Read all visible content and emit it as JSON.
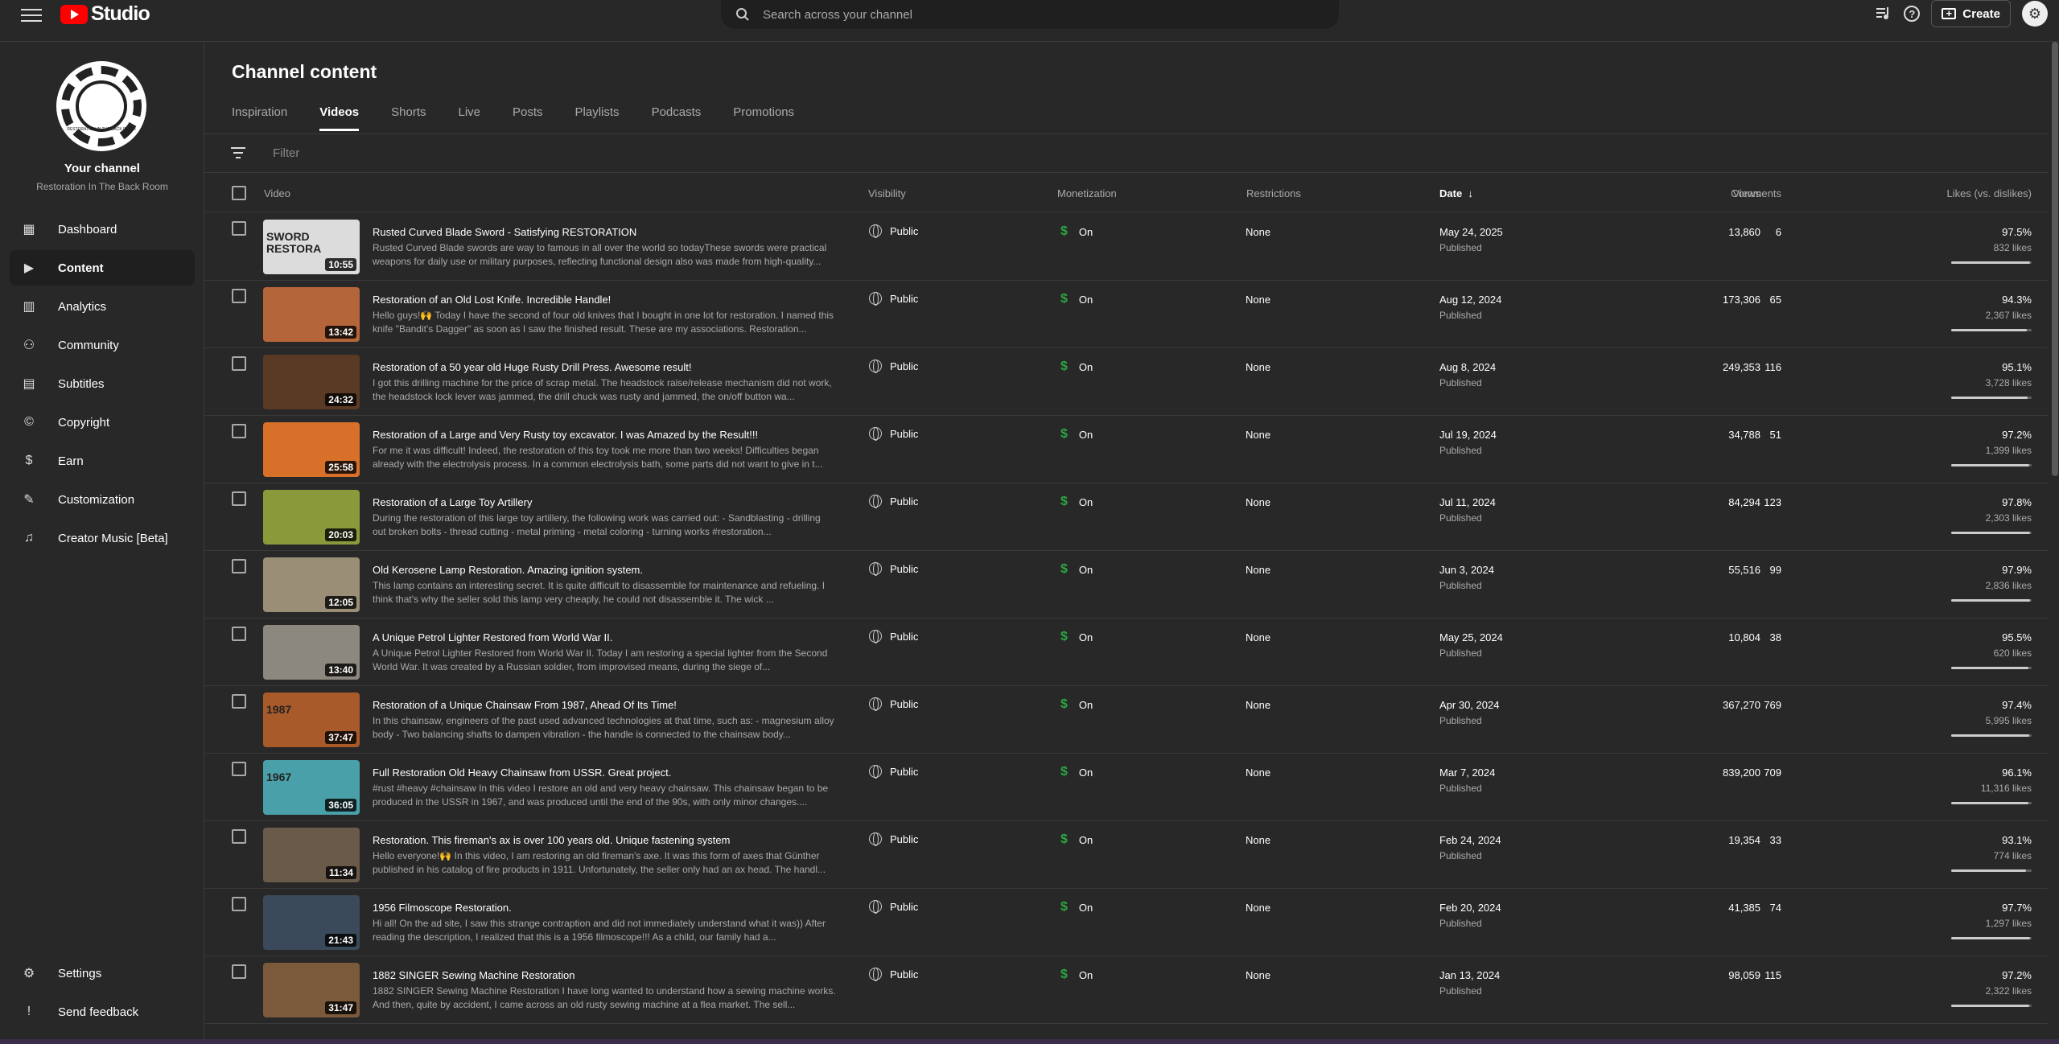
{
  "header": {
    "logo_text": "Studio",
    "search_placeholder": "Search across your channel",
    "create_label": "Create"
  },
  "sidebar": {
    "your_channel": "Your channel",
    "channel_name": "Restoration In The Back Room",
    "avatar_text": "RESTORATION IN THE BACK ROOM",
    "items": [
      {
        "label": "Dashboard",
        "icon": "dashboard-icon"
      },
      {
        "label": "Content",
        "icon": "content-icon"
      },
      {
        "label": "Analytics",
        "icon": "analytics-icon"
      },
      {
        "label": "Community",
        "icon": "community-icon"
      },
      {
        "label": "Subtitles",
        "icon": "subtitles-icon"
      },
      {
        "label": "Copyright",
        "icon": "copyright-icon"
      },
      {
        "label": "Earn",
        "icon": "earn-icon"
      },
      {
        "label": "Customization",
        "icon": "customization-icon"
      },
      {
        "label": "Creator Music [Beta]",
        "icon": "music-icon"
      }
    ],
    "settings": "Settings",
    "feedback": "Send feedback"
  },
  "main": {
    "title": "Channel content",
    "tabs": [
      "Inspiration",
      "Videos",
      "Shorts",
      "Live",
      "Posts",
      "Playlists",
      "Podcasts",
      "Promotions"
    ],
    "active_tab": "Videos",
    "filter_placeholder": "Filter",
    "columns": {
      "video": "Video",
      "visibility": "Visibility",
      "monetization": "Monetization",
      "restrictions": "Restrictions",
      "date": "Date",
      "views": "Views",
      "comments": "Comments",
      "likes": "Likes (vs. dislikes)"
    }
  },
  "rows": [
    {
      "title": "Rusted Curved Blade Sword - Satisfying RESTORATION",
      "desc": "Rusted Curved Blade swords are way to famous in all over the world so todayThese swords were practical weapons for daily use or military purposes, reflecting functional design also was made from high-quality...",
      "duration": "10:55",
      "visibility": "Public",
      "monetization": "On",
      "restrictions": "None",
      "date": "May 24, 2025",
      "status": "Published",
      "views": "13,860",
      "comments": "6",
      "likes_pct": "97.5%",
      "likes_count": "832 likes",
      "like_ratio": 0.975,
      "thumb_color": "#dcdcdc",
      "thumb_text": "SWORD RESTORA"
    },
    {
      "title": "Restoration of an Old Lost Knife. Incredible Handle!",
      "desc": "Hello guys!🙌 Today I have the second of four old knives that I bought in one lot for restoration. I named this knife \"Bandit's Dagger\" as soon as I saw the finished result. These are my associations. Restoration...",
      "duration": "13:42",
      "visibility": "Public",
      "monetization": "On",
      "restrictions": "None",
      "date": "Aug 12, 2024",
      "status": "Published",
      "views": "173,306",
      "comments": "65",
      "likes_pct": "94.3%",
      "likes_count": "2,367 likes",
      "like_ratio": 0.943,
      "thumb_color": "#b5653a",
      "thumb_text": ""
    },
    {
      "title": "Restoration of a 50 year old Huge Rusty Drill Press. Awesome result!",
      "desc": "I got this drilling machine for the price of scrap metal. The headstock raise/release mechanism did not work, the headstock lock lever was jammed, the drill chuck was rusty and jammed, the on/off button wa...",
      "duration": "24:32",
      "visibility": "Public",
      "monetization": "On",
      "restrictions": "None",
      "date": "Aug 8, 2024",
      "status": "Published",
      "views": "249,353",
      "comments": "116",
      "likes_pct": "95.1%",
      "likes_count": "3,728 likes",
      "like_ratio": 0.951,
      "thumb_color": "#5a3a24",
      "thumb_text": ""
    },
    {
      "title": "Restoration of a Large and Very Rusty toy excavator. I was Amazed by the Result!!!",
      "desc": "For me it was difficult! Indeed, the restoration of this toy took me more than two weeks! Difficulties began already with the electrolysis process. In a common electrolysis bath, some parts did not want to give in t...",
      "duration": "25:58",
      "visibility": "Public",
      "monetization": "On",
      "restrictions": "None",
      "date": "Jul 19, 2024",
      "status": "Published",
      "views": "34,788",
      "comments": "51",
      "likes_pct": "97.2%",
      "likes_count": "1,399 likes",
      "like_ratio": 0.972,
      "thumb_color": "#d8702a",
      "thumb_text": ""
    },
    {
      "title": "Restoration of a Large Toy Artillery",
      "desc": "During the restoration of this large toy artillery, the following work was carried out: - Sandblasting - drilling out broken bolts - thread cutting - metal priming - metal coloring - turning works #restoration...",
      "duration": "20:03",
      "visibility": "Public",
      "monetization": "On",
      "restrictions": "None",
      "date": "Jul 11, 2024",
      "status": "Published",
      "views": "84,294",
      "comments": "123",
      "likes_pct": "97.8%",
      "likes_count": "2,303 likes",
      "like_ratio": 0.978,
      "thumb_color": "#8a9a3a",
      "thumb_text": ""
    },
    {
      "title": "Old Kerosene Lamp Restoration. Amazing ignition system.",
      "desc": "This lamp contains an interesting secret. It is quite difficult to disassemble for maintenance and refueling. I think that's why the seller sold this lamp very cheaply, he could not disassemble it. The wick ...",
      "duration": "12:05",
      "visibility": "Public",
      "monetization": "On",
      "restrictions": "None",
      "date": "Jun 3, 2024",
      "status": "Published",
      "views": "55,516",
      "comments": "99",
      "likes_pct": "97.9%",
      "likes_count": "2,836 likes",
      "like_ratio": 0.979,
      "thumb_color": "#9a8e76",
      "thumb_text": ""
    },
    {
      "title": "A Unique Petrol Lighter Restored from World War II.",
      "desc": "A Unique Petrol Lighter Restored from World War II. Today I am restoring a special lighter from the Second World War. It was created by a Russian soldier, from improvised means, during the siege of...",
      "duration": "13:40",
      "visibility": "Public",
      "monetization": "On",
      "restrictions": "None",
      "date": "May 25, 2024",
      "status": "Published",
      "views": "10,804",
      "comments": "38",
      "likes_pct": "95.5%",
      "likes_count": "620 likes",
      "like_ratio": 0.955,
      "thumb_color": "#8c8880",
      "thumb_text": ""
    },
    {
      "title": "Restoration of a Unique Chainsaw From 1987, Ahead Of Its Time!",
      "desc": "In this chainsaw, engineers of the past used advanced technologies at that time, such as: - magnesium alloy body - Two balancing shafts to dampen vibration - the handle is connected to the chainsaw body...",
      "duration": "37:47",
      "visibility": "Public",
      "monetization": "On",
      "restrictions": "None",
      "date": "Apr 30, 2024",
      "status": "Published",
      "views": "367,270",
      "comments": "769",
      "likes_pct": "97.4%",
      "likes_count": "5,995 likes",
      "like_ratio": 0.974,
      "thumb_color": "#a85a2a",
      "thumb_text": "1987"
    },
    {
      "title": "Full Restoration Old Heavy Chainsaw from USSR. Great project.",
      "desc": "#rust #heavy #chainsaw In this video I restore an old and very heavy chainsaw. This chainsaw began to be produced in the USSR in 1967, and was produced until the end of the 90s, with only minor changes....",
      "duration": "36:05",
      "visibility": "Public",
      "monetization": "On",
      "restrictions": "None",
      "date": "Mar 7, 2024",
      "status": "Published",
      "views": "839,200",
      "comments": "709",
      "likes_pct": "96.1%",
      "likes_count": "11,316 likes",
      "like_ratio": 0.961,
      "thumb_color": "#4aa0a8",
      "thumb_text": "1967"
    },
    {
      "title": "Restoration. This fireman's ax is over 100 years old. Unique fastening system",
      "desc": "Hello everyone!🙌 In this video, I am restoring an old fireman's axe. It was this form of axes that Günther published in his catalog of fire products in 1911. Unfortunately, the seller only had an ax head. The handl...",
      "duration": "11:34",
      "visibility": "Public",
      "monetization": "On",
      "restrictions": "None",
      "date": "Feb 24, 2024",
      "status": "Published",
      "views": "19,354",
      "comments": "33",
      "likes_pct": "93.1%",
      "likes_count": "774 likes",
      "like_ratio": 0.931,
      "thumb_color": "#6a5a4a",
      "thumb_text": ""
    },
    {
      "title": "1956 Filmoscope Restoration.",
      "desc": "Hi all! On the ad site, I saw this strange contraption and did not immediately understand what it was)) After reading the description, I realized that this is a 1956 filmoscope!!! As a child, our family had a...",
      "duration": "21:43",
      "visibility": "Public",
      "monetization": "On",
      "restrictions": "None",
      "date": "Feb 20, 2024",
      "status": "Published",
      "views": "41,385",
      "comments": "74",
      "likes_pct": "97.7%",
      "likes_count": "1,297 likes",
      "like_ratio": 0.977,
      "thumb_color": "#3a4a5a",
      "thumb_text": ""
    },
    {
      "title": "1882 SINGER Sewing Machine Restoration",
      "desc": "1882 SINGER Sewing Machine Restoration I have long wanted to understand how a sewing machine works. And then, quite by accident, I came across an old rusty sewing machine at a flea market. The sell...",
      "duration": "31:47",
      "visibility": "Public",
      "monetization": "On",
      "restrictions": "None",
      "date": "Jan 13, 2024",
      "status": "Published",
      "views": "98,059",
      "comments": "115",
      "likes_pct": "97.2%",
      "likes_count": "2,322 likes",
      "like_ratio": 0.972,
      "thumb_color": "#7a5a3a",
      "thumb_text": ""
    }
  ]
}
